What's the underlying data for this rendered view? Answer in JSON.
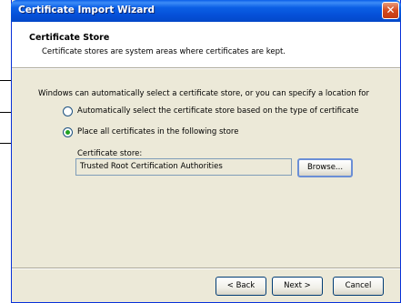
{
  "window": {
    "title": "Certificate Import Wizard",
    "close_glyph": "✕"
  },
  "header": {
    "title": "Certificate Store",
    "description": "Certificate stores are system areas where certificates are kept."
  },
  "body": {
    "intro": "Windows can automatically select a certificate store, or you can specify a location for",
    "options": [
      {
        "label": "Automatically select the certificate store based on the type of certificate",
        "selected": false
      },
      {
        "label": "Place all certificates in the following store",
        "selected": true
      }
    ],
    "store_label": "Certificate store:",
    "store_value": "Trusted Root Certification Authorities",
    "browse_label": "Browse..."
  },
  "footer": {
    "back_label": "< Back",
    "next_label": "Next >",
    "cancel_label": "Cancel"
  },
  "colors": {
    "titlebar": "#0550d8",
    "dialog_bg": "#ece9d8",
    "radio_selected": "#21a121"
  }
}
